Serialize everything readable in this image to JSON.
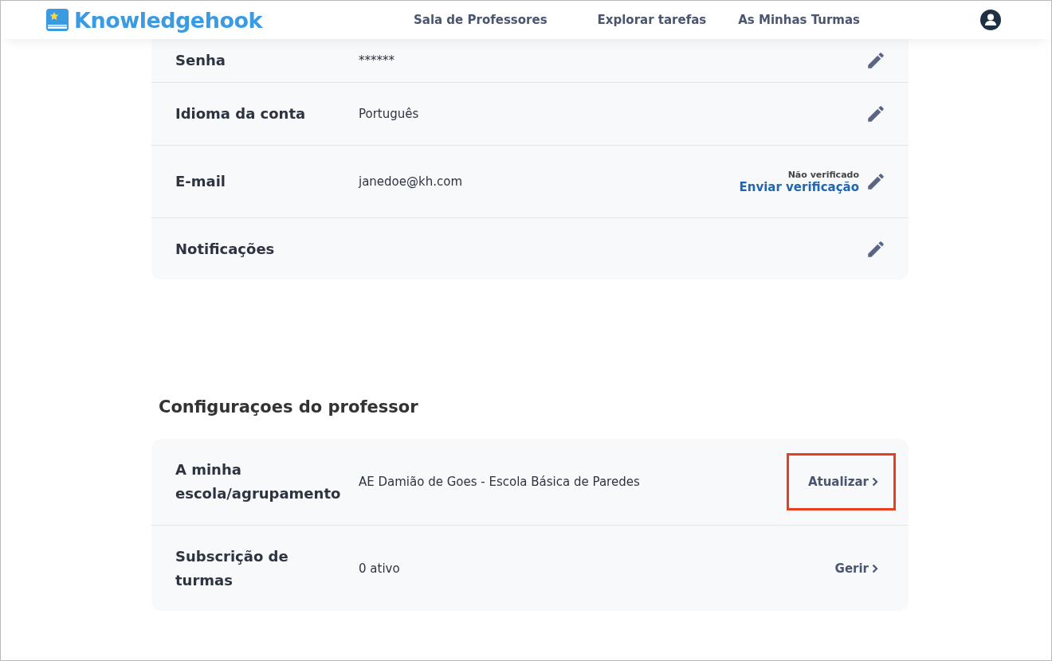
{
  "header": {
    "logo": "Knowledgehook",
    "nav": [
      {
        "label": "Sala de Professores"
      },
      {
        "label": "Explorar tarefas"
      },
      {
        "label": "As Minhas Turmas"
      }
    ]
  },
  "account_settings": [
    {
      "label": "Senha",
      "value": "******",
      "action": {
        "kind": "edit"
      }
    },
    {
      "label": "Idioma da conta",
      "value": "Português",
      "action": {
        "kind": "edit"
      }
    },
    {
      "label": "E-mail",
      "value": "janedoe@kh.com",
      "status": "Não verificado",
      "link": "Enviar verificação",
      "action": {
        "kind": "edit"
      }
    },
    {
      "label": "Notificações",
      "action": {
        "kind": "edit"
      }
    }
  ],
  "teacher_settings": {
    "title": "Configuraçoes do professor",
    "rows": [
      {
        "label": "A minha escola/agrupamento",
        "value": "AE Damião de Goes - Escola Básica de Paredes",
        "action": {
          "kind": "link",
          "label": "Atualizar",
          "highlighted": true
        }
      },
      {
        "label": "Subscrição de turmas",
        "value": "0 ativo",
        "action": {
          "kind": "link",
          "label": "Gerir",
          "highlighted": false
        }
      }
    ]
  }
}
